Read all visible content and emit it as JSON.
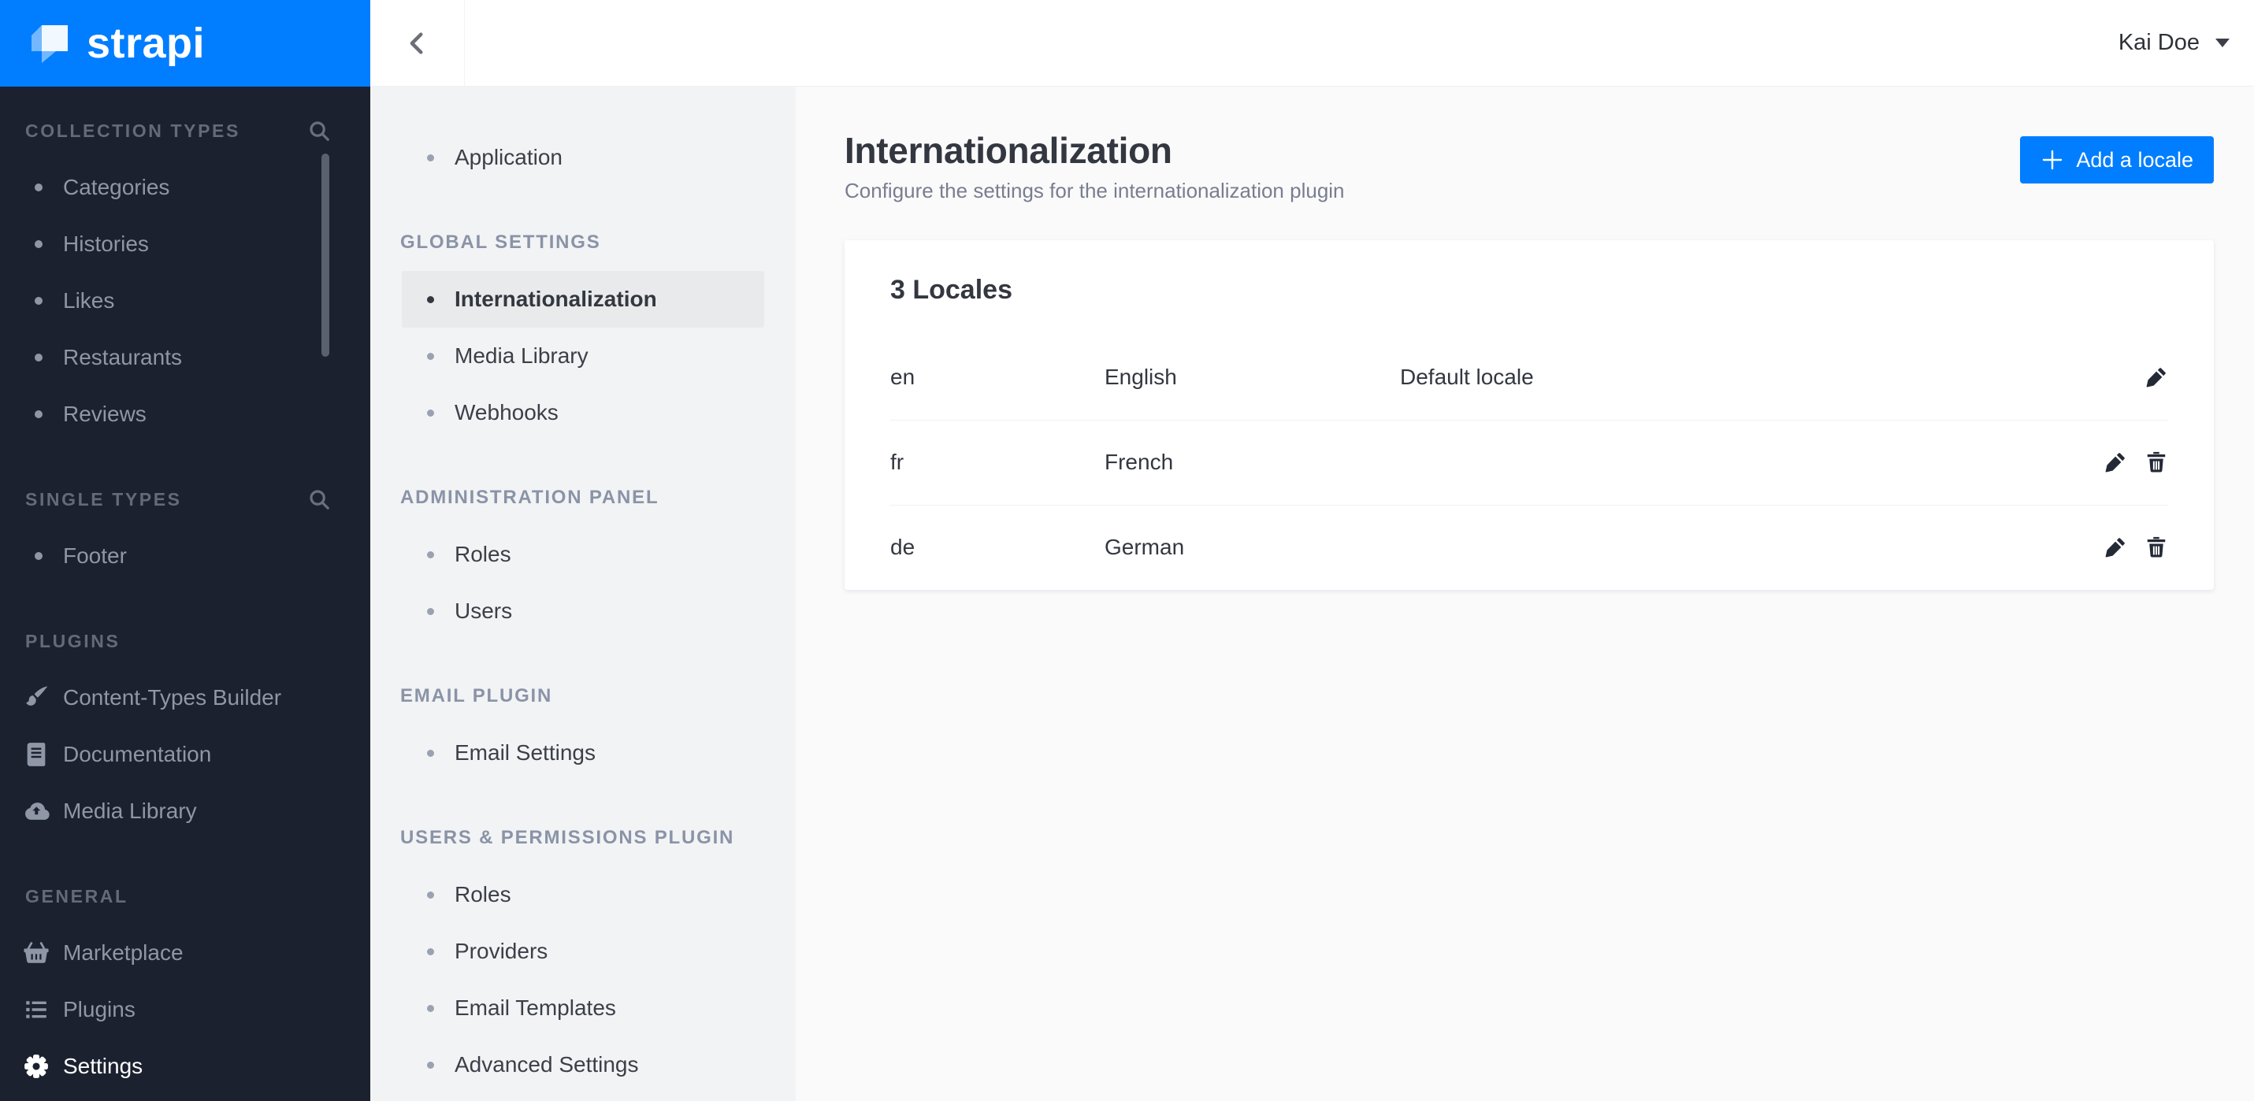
{
  "brand": {
    "logo_text": "strapi"
  },
  "colors": {
    "accent": "#007eff",
    "sidebar_bg": "#1b212e",
    "sidebar_text": "#8f97a6",
    "panel_bg": "#f2f3f4",
    "content_bg": "#fafafb",
    "text_dark": "#333740",
    "text_muted": "#787e8f"
  },
  "topbar": {
    "user_name": "Kai Doe"
  },
  "sidebar": {
    "sections": [
      {
        "title": "COLLECTION TYPES",
        "search": true,
        "items": [
          {
            "label": "Categories",
            "icon": "bullet"
          },
          {
            "label": "Histories",
            "icon": "bullet"
          },
          {
            "label": "Likes",
            "icon": "bullet"
          },
          {
            "label": "Restaurants",
            "icon": "bullet"
          },
          {
            "label": "Reviews",
            "icon": "bullet"
          }
        ]
      },
      {
        "title": "SINGLE TYPES",
        "search": true,
        "items": [
          {
            "label": "Footer",
            "icon": "bullet"
          }
        ]
      },
      {
        "title": "PLUGINS",
        "search": false,
        "items": [
          {
            "label": "Content-Types Builder",
            "icon": "paint-brush"
          },
          {
            "label": "Documentation",
            "icon": "book"
          },
          {
            "label": "Media Library",
            "icon": "cloud-upload"
          }
        ]
      },
      {
        "title": "GENERAL",
        "search": false,
        "items": [
          {
            "label": "Marketplace",
            "icon": "shopping-basket"
          },
          {
            "label": "Plugins",
            "icon": "list"
          },
          {
            "label": "Settings",
            "icon": "gear",
            "active": true
          }
        ]
      }
    ]
  },
  "settings_nav": {
    "groups": [
      {
        "items": [
          {
            "label": "Application"
          }
        ]
      },
      {
        "title": "GLOBAL SETTINGS",
        "items": [
          {
            "label": "Internationalization",
            "active": true
          },
          {
            "label": "Media Library"
          },
          {
            "label": "Webhooks"
          }
        ]
      },
      {
        "title": "ADMINISTRATION PANEL",
        "items": [
          {
            "label": "Roles"
          },
          {
            "label": "Users"
          }
        ]
      },
      {
        "title": "EMAIL PLUGIN",
        "items": [
          {
            "label": "Email Settings"
          }
        ]
      },
      {
        "title": "USERS & PERMISSIONS PLUGIN",
        "items": [
          {
            "label": "Roles"
          },
          {
            "label": "Providers"
          },
          {
            "label": "Email Templates"
          },
          {
            "label": "Advanced Settings"
          }
        ]
      }
    ]
  },
  "main": {
    "title": "Internationalization",
    "subtitle": "Configure the settings for the internationalization plugin",
    "add_locale_button": "Add a locale",
    "locales_card": {
      "title": "3 Locales",
      "rows": [
        {
          "code": "en",
          "name": "English",
          "note": "Default locale",
          "actions": [
            "edit"
          ]
        },
        {
          "code": "fr",
          "name": "French",
          "note": "",
          "actions": [
            "edit",
            "delete"
          ]
        },
        {
          "code": "de",
          "name": "German",
          "note": "",
          "actions": [
            "edit",
            "delete"
          ]
        }
      ]
    }
  }
}
